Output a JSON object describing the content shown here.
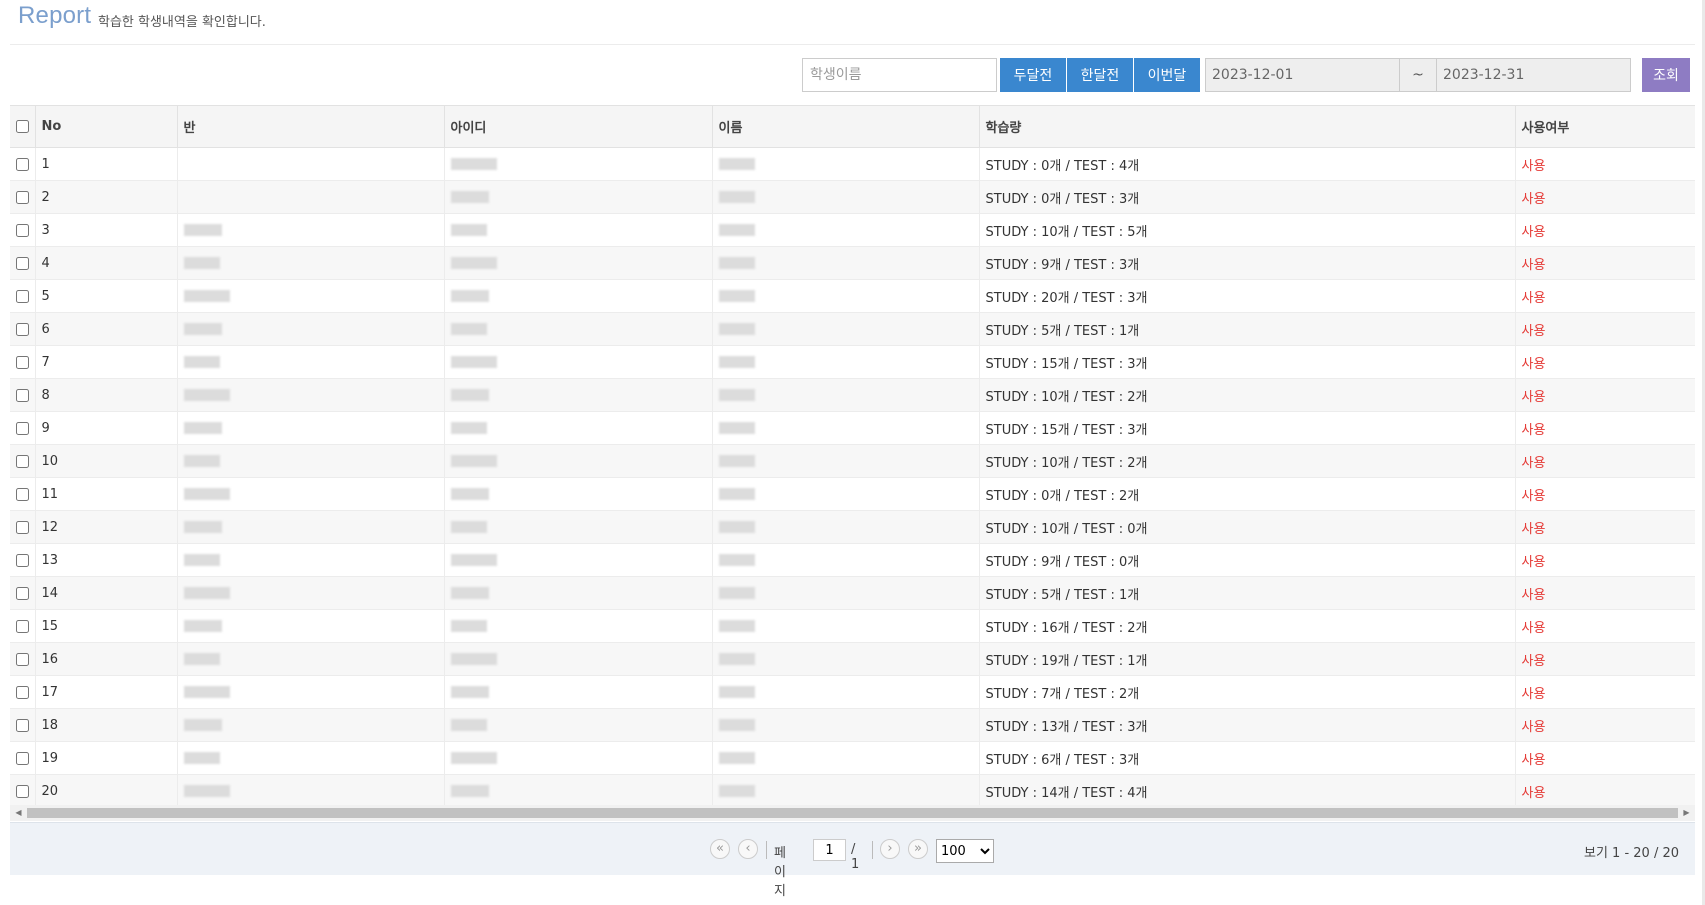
{
  "header": {
    "title": "Report",
    "subtitle": "학습한 학생내역을 확인합니다."
  },
  "toolbar": {
    "search_placeholder": "학생이름",
    "two_months_label": "두달전",
    "one_month_label": "한달전",
    "this_month_label": "이번달",
    "start_date": "2023-12-01",
    "separator": "~",
    "end_date": "2023-12-31",
    "search_label": "조회"
  },
  "table": {
    "columns": [
      "No",
      "반",
      "아이디",
      "이름",
      "학습량",
      "사용여부"
    ],
    "rows": [
      {
        "no": "1",
        "study": "STUDY : 0개 / TEST : 4개",
        "status": "사용"
      },
      {
        "no": "2",
        "study": "STUDY : 0개 / TEST : 3개",
        "status": "사용"
      },
      {
        "no": "3",
        "study": "STUDY : 10개 / TEST : 5개",
        "status": "사용"
      },
      {
        "no": "4",
        "study": "STUDY : 9개 / TEST : 3개",
        "status": "사용"
      },
      {
        "no": "5",
        "study": "STUDY : 20개 / TEST : 3개",
        "status": "사용"
      },
      {
        "no": "6",
        "study": "STUDY : 5개 / TEST : 1개",
        "status": "사용"
      },
      {
        "no": "7",
        "study": "STUDY : 15개 / TEST : 3개",
        "status": "사용"
      },
      {
        "no": "8",
        "study": "STUDY : 10개 / TEST : 2개",
        "status": "사용"
      },
      {
        "no": "9",
        "study": "STUDY : 15개 / TEST : 3개",
        "status": "사용"
      },
      {
        "no": "10",
        "study": "STUDY : 10개 / TEST : 2개",
        "status": "사용"
      },
      {
        "no": "11",
        "study": "STUDY : 0개 / TEST : 2개",
        "status": "사용"
      },
      {
        "no": "12",
        "study": "STUDY : 10개 / TEST : 0개",
        "status": "사용"
      },
      {
        "no": "13",
        "study": "STUDY : 9개 / TEST : 0개",
        "status": "사용"
      },
      {
        "no": "14",
        "study": "STUDY : 5개 / TEST : 1개",
        "status": "사용"
      },
      {
        "no": "15",
        "study": "STUDY : 16개 / TEST : 2개",
        "status": "사용"
      },
      {
        "no": "16",
        "study": "STUDY : 19개 / TEST : 1개",
        "status": "사용"
      },
      {
        "no": "17",
        "study": "STUDY : 7개 / TEST : 2개",
        "status": "사용"
      },
      {
        "no": "18",
        "study": "STUDY : 13개 / TEST : 3개",
        "status": "사용"
      },
      {
        "no": "19",
        "study": "STUDY : 6개 / TEST : 3개",
        "status": "사용"
      },
      {
        "no": "20",
        "study": "STUDY : 14개 / TEST : 4개",
        "status": "사용"
      }
    ]
  },
  "pager": {
    "first_icon": "double-chevron-left-icon",
    "prev_icon": "chevron-left-icon",
    "next_icon": "chevron-right-icon",
    "last_icon": "double-chevron-right-icon",
    "page_label": "페이지",
    "current_page": "1",
    "total_pages": "/ 1",
    "page_size": "100",
    "view_info": "보기 1 - 20 / 20"
  },
  "colors": {
    "title": "#7b9fcd",
    "primary_button": "#3a87cf",
    "search_button": "#8e7cc3",
    "status_active": "#e53935"
  }
}
